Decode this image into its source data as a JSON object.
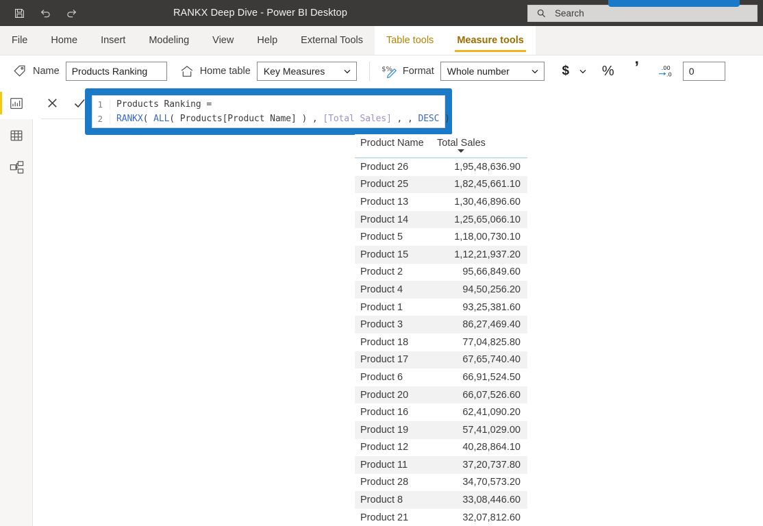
{
  "titlebar": {
    "app_title": "RANKX Deep Dive - Power BI Desktop",
    "icons": [
      {
        "name": "save-icon",
        "label": "Save"
      },
      {
        "name": "undo-icon",
        "label": "Undo"
      },
      {
        "name": "redo-icon",
        "label": "Redo"
      }
    ],
    "search_placeholder": "Search",
    "accent_blue": "#1b7ac7"
  },
  "ribbon": {
    "tabs": [
      {
        "label": "File",
        "contextual": false,
        "active": false
      },
      {
        "label": "Home",
        "contextual": false,
        "active": false
      },
      {
        "label": "Insert",
        "contextual": false,
        "active": false
      },
      {
        "label": "Modeling",
        "contextual": false,
        "active": false
      },
      {
        "label": "View",
        "contextual": false,
        "active": false
      },
      {
        "label": "Help",
        "contextual": false,
        "active": false
      },
      {
        "label": "External Tools",
        "contextual": false,
        "active": false
      },
      {
        "label": "Table tools",
        "contextual": true,
        "active": false
      },
      {
        "label": "Measure tools",
        "contextual": true,
        "active": true
      }
    ],
    "contextual_color": "#b58300",
    "active_underline_color": "#f0b323"
  },
  "toolbar": {
    "name_label": "Name",
    "name_value": "Products Ranking",
    "home_table_label": "Home table",
    "home_table_value": "Key Measures",
    "format_label": "Format",
    "format_value": "Whole number",
    "currency_symbol": "$",
    "percent_symbol": "%",
    "thousands_symbol": "’",
    "decimal_places_value": "0",
    "icons": [
      {
        "name": "tag-icon"
      },
      {
        "name": "home-icon"
      },
      {
        "name": "format-icon"
      },
      {
        "name": "currency-icon"
      },
      {
        "name": "percent-icon"
      },
      {
        "name": "comma-icon"
      },
      {
        "name": "decimal-places-icon"
      }
    ]
  },
  "leftnav": {
    "items": [
      {
        "name": "report-view",
        "icon": "bar-chart-icon",
        "active": true
      },
      {
        "name": "data-view",
        "icon": "table-icon",
        "active": false
      },
      {
        "name": "model-view",
        "icon": "model-relationships-icon",
        "active": false
      }
    ],
    "active_indicator_color": "#f2c811"
  },
  "formula_bar": {
    "cancel_icon": "close-icon",
    "accept_icon": "checkmark-icon",
    "lines": [
      {
        "number": "1",
        "tokens": [
          {
            "t": "plain",
            "s": "Products Ranking ="
          }
        ]
      },
      {
        "number": "2",
        "tokens": [
          {
            "t": "fn",
            "s": "RANKX"
          },
          {
            "t": "plain",
            "s": "( "
          },
          {
            "t": "fn",
            "s": "ALL"
          },
          {
            "t": "plain",
            "s": "( Products[Product Name] ) , "
          },
          {
            "t": "meas",
            "s": "[Total Sales]"
          },
          {
            "t": "plain",
            "s": " , , "
          },
          {
            "t": "key",
            "s": "DESC"
          },
          {
            "t": "plain",
            "s": " )"
          }
        ]
      }
    ],
    "plain_text": "Products Ranking = RANKX( ALL( Products[Product Name] ) , [Total Sales] , , DESC )",
    "annotation_color": "#1b7ac7"
  },
  "table_visual": {
    "columns": [
      "Product Name",
      "Total Sales"
    ],
    "sort_column": "Total Sales",
    "sort_direction": "descending",
    "rows": [
      {
        "name": "Product 26",
        "value": "1,95,48,636.90"
      },
      {
        "name": "Product 25",
        "value": "1,82,45,661.10"
      },
      {
        "name": "Product 13",
        "value": "1,30,46,896.60"
      },
      {
        "name": "Product 14",
        "value": "1,25,65,066.10"
      },
      {
        "name": "Product 5",
        "value": "1,18,00,730.10"
      },
      {
        "name": "Product 15",
        "value": "1,12,21,937.20"
      },
      {
        "name": "Product 2",
        "value": "95,66,849.60"
      },
      {
        "name": "Product 4",
        "value": "94,50,256.20"
      },
      {
        "name": "Product 1",
        "value": "93,25,381.60"
      },
      {
        "name": "Product 3",
        "value": "86,27,469.40"
      },
      {
        "name": "Product 18",
        "value": "77,04,825.80"
      },
      {
        "name": "Product 17",
        "value": "67,65,740.40"
      },
      {
        "name": "Product 6",
        "value": "66,91,524.50"
      },
      {
        "name": "Product 20",
        "value": "66,07,526.60"
      },
      {
        "name": "Product 16",
        "value": "62,41,090.20"
      },
      {
        "name": "Product 19",
        "value": "57,41,029.00"
      },
      {
        "name": "Product 12",
        "value": "40,28,864.10"
      },
      {
        "name": "Product 11",
        "value": "37,20,737.80"
      },
      {
        "name": "Product 28",
        "value": "34,70,573.20"
      },
      {
        "name": "Product 8",
        "value": "33,08,446.60"
      },
      {
        "name": "Product 21",
        "value": "32,07,812.60"
      }
    ]
  },
  "chart_data": {
    "type": "table",
    "title": "",
    "columns": [
      "Product Name",
      "Total Sales"
    ],
    "categories": [
      "Product 26",
      "Product 25",
      "Product 13",
      "Product 14",
      "Product 5",
      "Product 15",
      "Product 2",
      "Product 4",
      "Product 1",
      "Product 3",
      "Product 18",
      "Product 17",
      "Product 6",
      "Product 20",
      "Product 16",
      "Product 19",
      "Product 12",
      "Product 11",
      "Product 28",
      "Product 8",
      "Product 21"
    ],
    "values": [
      19548636.9,
      18245661.1,
      13046896.6,
      12565066.1,
      11800730.1,
      11221937.2,
      9566849.6,
      9450256.2,
      9325381.6,
      8627469.4,
      7704825.8,
      6765740.4,
      6691524.5,
      6607526.6,
      6241090.2,
      5741029.0,
      4028864.1,
      3720737.8,
      3470573.2,
      3308446.6,
      3207812.6
    ],
    "value_labels": [
      "1,95,48,636.90",
      "1,82,45,661.10",
      "1,30,46,896.60",
      "1,25,65,066.10",
      "1,18,00,730.10",
      "1,12,21,937.20",
      "95,66,849.60",
      "94,50,256.20",
      "93,25,381.60",
      "86,27,469.40",
      "77,04,825.80",
      "67,65,740.40",
      "66,91,524.50",
      "66,07,526.60",
      "62,41,090.20",
      "57,41,029.00",
      "40,28,864.10",
      "37,20,737.80",
      "34,70,573.20",
      "33,08,446.60",
      "32,07,812.60"
    ],
    "xlabel": "Product Name",
    "ylabel": "Total Sales",
    "sorted_by": "Total Sales",
    "sort_direction": "descending",
    "number_format": "indian-grouping-2-decimals"
  }
}
